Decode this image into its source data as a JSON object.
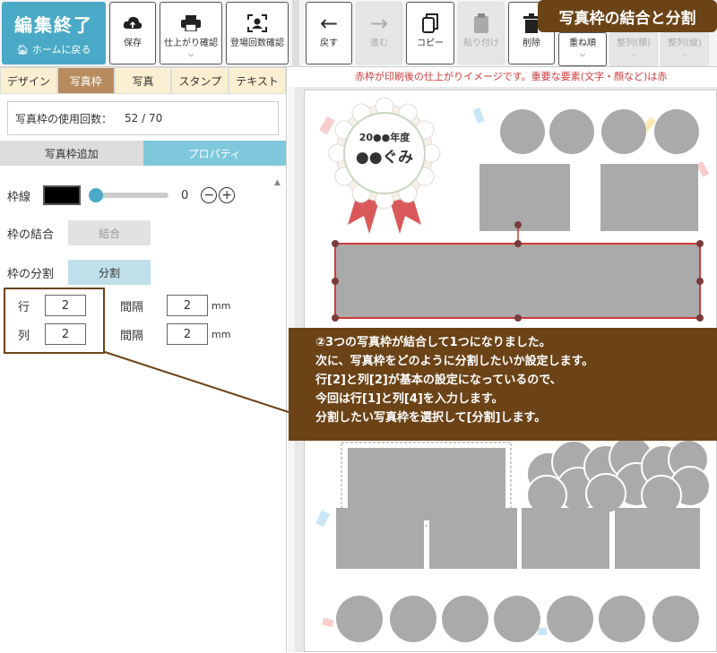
{
  "toolbar": {
    "edit_end": {
      "title": "編集終了",
      "subtitle": "ホームに戻る"
    },
    "buttons": [
      {
        "id": "save",
        "label": "保存",
        "icon": "cloud-upload-icon"
      },
      {
        "id": "preview",
        "label": "仕上がり確認",
        "icon": "printer-icon"
      },
      {
        "id": "registered",
        "label": "登場回数確認",
        "icon": "user-frame-icon"
      },
      {
        "id": "undo",
        "label": "戻す",
        "icon": "arrow-left-icon"
      },
      {
        "id": "redo",
        "label": "進む",
        "icon": "arrow-right-icon"
      },
      {
        "id": "copy",
        "label": "コピー",
        "icon": "copy-icon"
      },
      {
        "id": "paste",
        "label": "貼り付け",
        "icon": "clipboard-icon"
      },
      {
        "id": "delete",
        "label": "削除",
        "icon": "trash-icon"
      },
      {
        "id": "order",
        "label": "重ね順"
      },
      {
        "id": "align_h",
        "label": "整列(横)"
      },
      {
        "id": "align_v",
        "label": "整列(縦)"
      }
    ],
    "title_badge": "写真枠の結合と分割"
  },
  "left_panel": {
    "tabs": [
      "デザイン",
      "写真枠",
      "写真",
      "スタンプ",
      "テキスト"
    ],
    "active_tab": "写真枠",
    "usage": {
      "label": "写真枠の使用回数：",
      "value": "52 / 70"
    },
    "subtabs": [
      "写真枠追加",
      "プロパティ"
    ],
    "active_subtab": "プロパティ",
    "border": {
      "label": "枠線",
      "value": "0",
      "color": "#000000"
    },
    "merge": {
      "label": "枠の結合",
      "button": "結合"
    },
    "split": {
      "label": "枠の分割",
      "button": "分割"
    },
    "rows": {
      "label": "行",
      "value": "2",
      "gap_label": "間隔",
      "gap_value": "2",
      "unit": "mm"
    },
    "cols": {
      "label": "列",
      "value": "2",
      "gap_label": "間隔",
      "gap_value": "2",
      "unit": "mm"
    }
  },
  "canvas": {
    "note": "赤枠が印刷後の仕上がりイメージです。重要な要素(文字・顔など)は赤",
    "badge_line1": "20●●年度",
    "badge_line2": "●●ぐみ"
  },
  "callout": {
    "lines": [
      "②3つの写真枠が結合して1つになりました。",
      "次に、写真枠をどのように分割したいか設定します。",
      "行[2]と列[2]が基本の設定になっているので、",
      "今回は行[1]と列[4]を入力します。",
      "分割したい写真枠を選択して[分割]します。"
    ]
  },
  "colors": {
    "accent": "#4aa9c6",
    "callout_bg": "#6b4317",
    "selection": "#d03a3a",
    "photo_frame": "#aaaaaa"
  }
}
